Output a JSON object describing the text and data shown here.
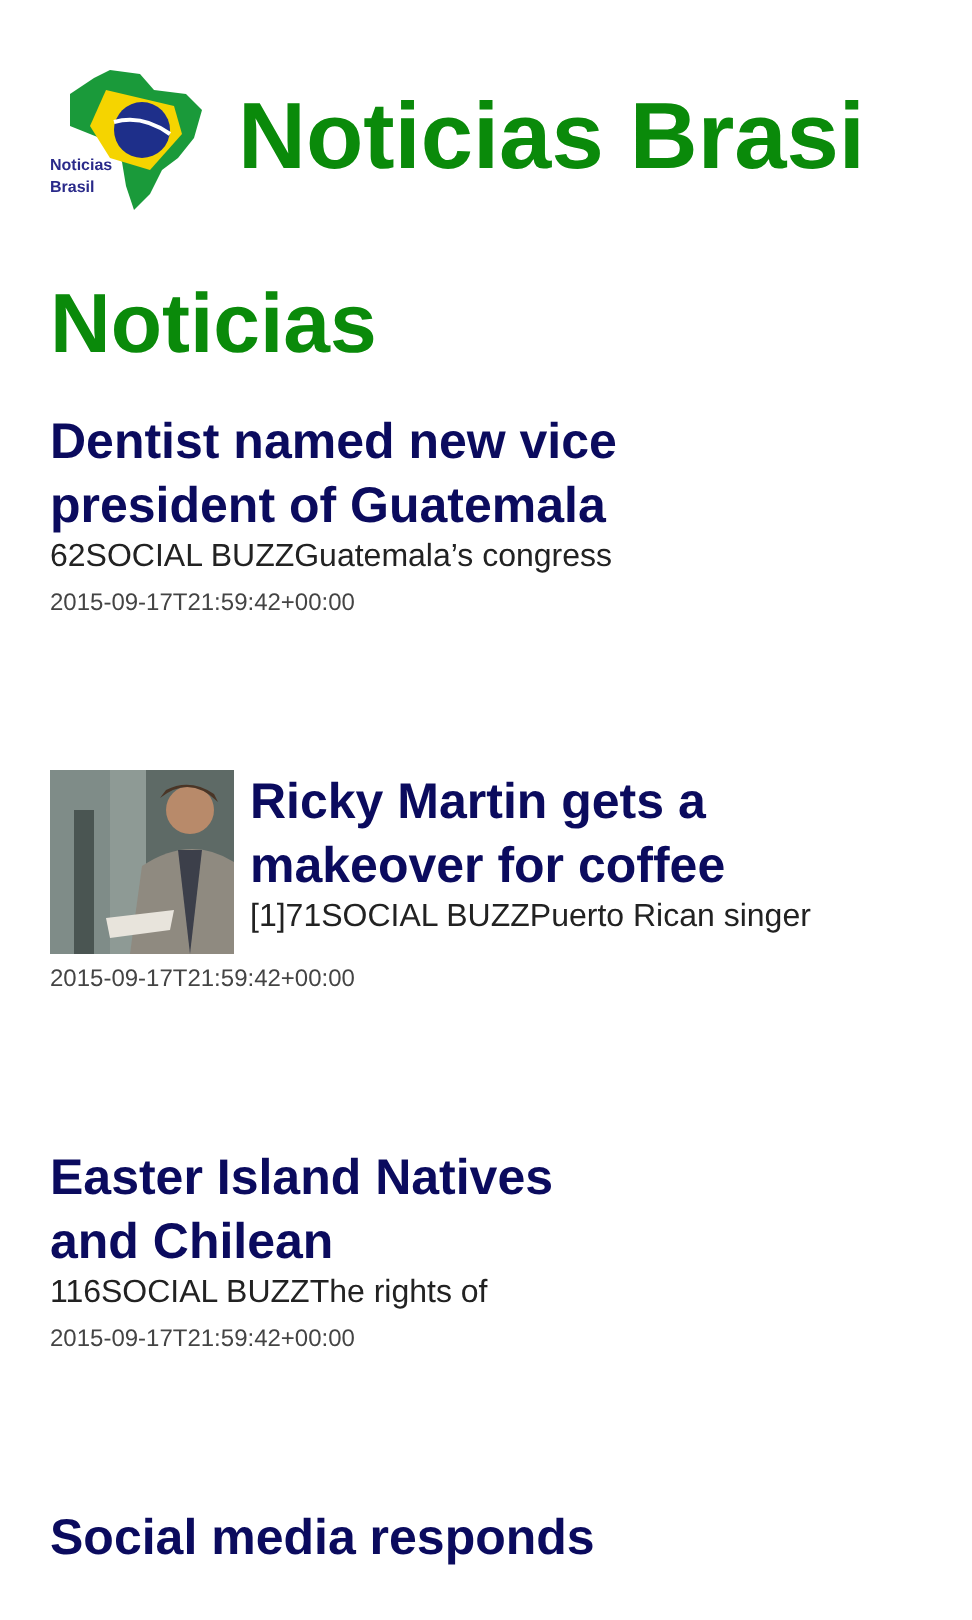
{
  "app": {
    "title": "Noticias Brasi",
    "logo_text": "Noticias Brasil"
  },
  "section": {
    "title": "Noticias"
  },
  "articles": [
    {
      "title": "Dentist named new vice president of Guatemala",
      "snippet": "62SOCIAL BUZZGuatemala’s congress",
      "date": "2015-09-17T21:59:42+00:00",
      "kind": "text"
    },
    {
      "title": "Ricky Martin gets a makeover for coffee",
      "snippet": "[1]71SOCIAL BUZZPuerto Rican singer",
      "date": "2015-09-17T21:59:42+00:00",
      "kind": "picture"
    },
    {
      "title": "Easter Island Natives and Chilean",
      "snippet": "116SOCIAL BUZZThe rights of",
      "date": "2015-09-17T21:59:42+00:00",
      "kind": "text"
    },
    {
      "title": "Social media responds",
      "kind": "text"
    }
  ]
}
